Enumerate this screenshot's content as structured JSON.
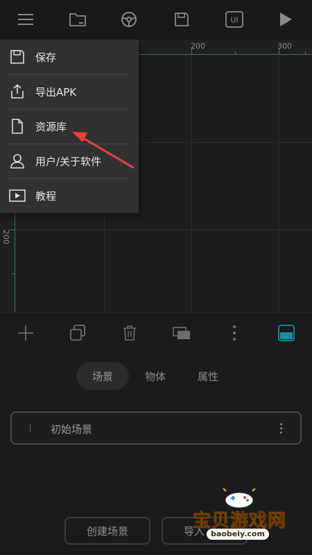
{
  "topbar": {
    "icons": [
      "menu-icon",
      "folder-icon",
      "steering-wheel-icon",
      "save-icon",
      "ui-icon",
      "play-icon"
    ],
    "ui_label": "UI"
  },
  "canvas": {
    "ruler_top_labels": [
      "200",
      "300"
    ],
    "ruler_left_labels": [
      "200"
    ]
  },
  "menu": {
    "items": [
      {
        "label": "保存",
        "icon": "save-icon"
      },
      {
        "label": "导出APK",
        "icon": "share-icon"
      },
      {
        "label": "资源库",
        "icon": "file-icon"
      },
      {
        "label": "用户/关于软件",
        "icon": "user-icon"
      },
      {
        "label": "教程",
        "icon": "video-icon"
      }
    ]
  },
  "toolbar": {
    "icons": [
      "add-icon",
      "duplicate-icon",
      "trash-icon",
      "layers-icon",
      "more-vertical-icon",
      "panel-toggle-icon"
    ]
  },
  "tabs": [
    {
      "label": "场景",
      "active": true
    },
    {
      "label": "物体",
      "active": false
    },
    {
      "label": "属性",
      "active": false
    }
  ],
  "scenes": [
    {
      "name": "初始场景"
    }
  ],
  "buttons": {
    "create_scene": "创建场景",
    "import_scene": "导入"
  },
  "watermark": {
    "text": "宝贝游戏网",
    "url": "baobeiy.com"
  },
  "colors": {
    "accent_green": "#1a8a3a",
    "annotation_arrow": "#e8403c",
    "panel_toggle": "#1c8aa0"
  }
}
